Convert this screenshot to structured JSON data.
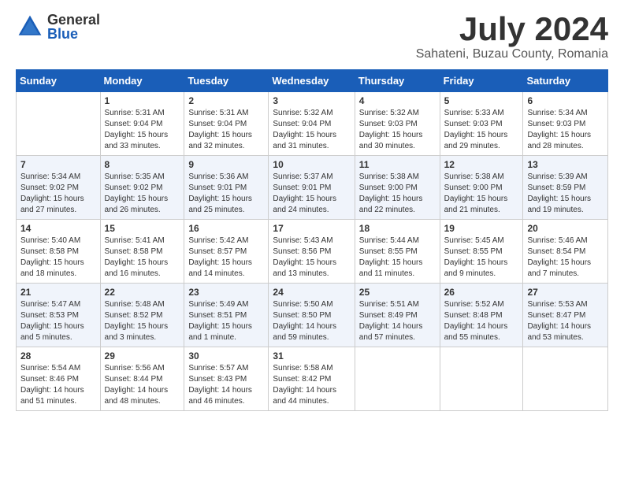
{
  "logo": {
    "general": "General",
    "blue": "Blue"
  },
  "header": {
    "month": "July 2024",
    "location": "Sahateni, Buzau County, Romania"
  },
  "weekdays": [
    "Sunday",
    "Monday",
    "Tuesday",
    "Wednesday",
    "Thursday",
    "Friday",
    "Saturday"
  ],
  "weeks": [
    [
      {
        "day": "",
        "info": ""
      },
      {
        "day": "1",
        "info": "Sunrise: 5:31 AM\nSunset: 9:04 PM\nDaylight: 15 hours\nand 33 minutes."
      },
      {
        "day": "2",
        "info": "Sunrise: 5:31 AM\nSunset: 9:04 PM\nDaylight: 15 hours\nand 32 minutes."
      },
      {
        "day": "3",
        "info": "Sunrise: 5:32 AM\nSunset: 9:04 PM\nDaylight: 15 hours\nand 31 minutes."
      },
      {
        "day": "4",
        "info": "Sunrise: 5:32 AM\nSunset: 9:03 PM\nDaylight: 15 hours\nand 30 minutes."
      },
      {
        "day": "5",
        "info": "Sunrise: 5:33 AM\nSunset: 9:03 PM\nDaylight: 15 hours\nand 29 minutes."
      },
      {
        "day": "6",
        "info": "Sunrise: 5:34 AM\nSunset: 9:03 PM\nDaylight: 15 hours\nand 28 minutes."
      }
    ],
    [
      {
        "day": "7",
        "info": "Sunrise: 5:34 AM\nSunset: 9:02 PM\nDaylight: 15 hours\nand 27 minutes."
      },
      {
        "day": "8",
        "info": "Sunrise: 5:35 AM\nSunset: 9:02 PM\nDaylight: 15 hours\nand 26 minutes."
      },
      {
        "day": "9",
        "info": "Sunrise: 5:36 AM\nSunset: 9:01 PM\nDaylight: 15 hours\nand 25 minutes."
      },
      {
        "day": "10",
        "info": "Sunrise: 5:37 AM\nSunset: 9:01 PM\nDaylight: 15 hours\nand 24 minutes."
      },
      {
        "day": "11",
        "info": "Sunrise: 5:38 AM\nSunset: 9:00 PM\nDaylight: 15 hours\nand 22 minutes."
      },
      {
        "day": "12",
        "info": "Sunrise: 5:38 AM\nSunset: 9:00 PM\nDaylight: 15 hours\nand 21 minutes."
      },
      {
        "day": "13",
        "info": "Sunrise: 5:39 AM\nSunset: 8:59 PM\nDaylight: 15 hours\nand 19 minutes."
      }
    ],
    [
      {
        "day": "14",
        "info": "Sunrise: 5:40 AM\nSunset: 8:58 PM\nDaylight: 15 hours\nand 18 minutes."
      },
      {
        "day": "15",
        "info": "Sunrise: 5:41 AM\nSunset: 8:58 PM\nDaylight: 15 hours\nand 16 minutes."
      },
      {
        "day": "16",
        "info": "Sunrise: 5:42 AM\nSunset: 8:57 PM\nDaylight: 15 hours\nand 14 minutes."
      },
      {
        "day": "17",
        "info": "Sunrise: 5:43 AM\nSunset: 8:56 PM\nDaylight: 15 hours\nand 13 minutes."
      },
      {
        "day": "18",
        "info": "Sunrise: 5:44 AM\nSunset: 8:55 PM\nDaylight: 15 hours\nand 11 minutes."
      },
      {
        "day": "19",
        "info": "Sunrise: 5:45 AM\nSunset: 8:55 PM\nDaylight: 15 hours\nand 9 minutes."
      },
      {
        "day": "20",
        "info": "Sunrise: 5:46 AM\nSunset: 8:54 PM\nDaylight: 15 hours\nand 7 minutes."
      }
    ],
    [
      {
        "day": "21",
        "info": "Sunrise: 5:47 AM\nSunset: 8:53 PM\nDaylight: 15 hours\nand 5 minutes."
      },
      {
        "day": "22",
        "info": "Sunrise: 5:48 AM\nSunset: 8:52 PM\nDaylight: 15 hours\nand 3 minutes."
      },
      {
        "day": "23",
        "info": "Sunrise: 5:49 AM\nSunset: 8:51 PM\nDaylight: 15 hours\nand 1 minute."
      },
      {
        "day": "24",
        "info": "Sunrise: 5:50 AM\nSunset: 8:50 PM\nDaylight: 14 hours\nand 59 minutes."
      },
      {
        "day": "25",
        "info": "Sunrise: 5:51 AM\nSunset: 8:49 PM\nDaylight: 14 hours\nand 57 minutes."
      },
      {
        "day": "26",
        "info": "Sunrise: 5:52 AM\nSunset: 8:48 PM\nDaylight: 14 hours\nand 55 minutes."
      },
      {
        "day": "27",
        "info": "Sunrise: 5:53 AM\nSunset: 8:47 PM\nDaylight: 14 hours\nand 53 minutes."
      }
    ],
    [
      {
        "day": "28",
        "info": "Sunrise: 5:54 AM\nSunset: 8:46 PM\nDaylight: 14 hours\nand 51 minutes."
      },
      {
        "day": "29",
        "info": "Sunrise: 5:56 AM\nSunset: 8:44 PM\nDaylight: 14 hours\nand 48 minutes."
      },
      {
        "day": "30",
        "info": "Sunrise: 5:57 AM\nSunset: 8:43 PM\nDaylight: 14 hours\nand 46 minutes."
      },
      {
        "day": "31",
        "info": "Sunrise: 5:58 AM\nSunset: 8:42 PM\nDaylight: 14 hours\nand 44 minutes."
      },
      {
        "day": "",
        "info": ""
      },
      {
        "day": "",
        "info": ""
      },
      {
        "day": "",
        "info": ""
      }
    ]
  ]
}
